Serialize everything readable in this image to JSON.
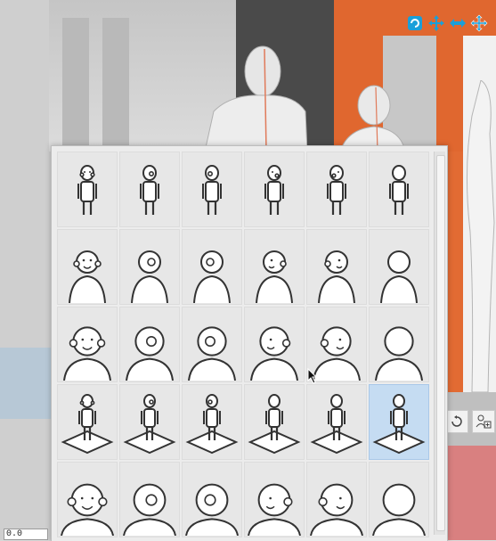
{
  "viewport": {
    "readout_value": "0.0"
  },
  "colors": {
    "accent": "#1a9fd9",
    "selected_cell": "#c5dcf2",
    "wood": "#e0672f",
    "panel": "#ececec"
  },
  "toolbar": {
    "icons": [
      "camera-rotate-icon",
      "camera-pan-icon",
      "camera-move-icon",
      "camera-zoom-icon"
    ]
  },
  "pose_panel": {
    "rows": 5,
    "columns": 6,
    "selected_row": 3,
    "selected_column": 5,
    "row_kinds": [
      "full-body-standing",
      "head-shoulders-small",
      "head-shoulders-large",
      "full-body-on-floor",
      "head-shoulders-closeup"
    ],
    "column_views": [
      "front",
      "right-profile",
      "left-profile",
      "three-quarter-left",
      "three-quarter-right",
      "back"
    ]
  }
}
